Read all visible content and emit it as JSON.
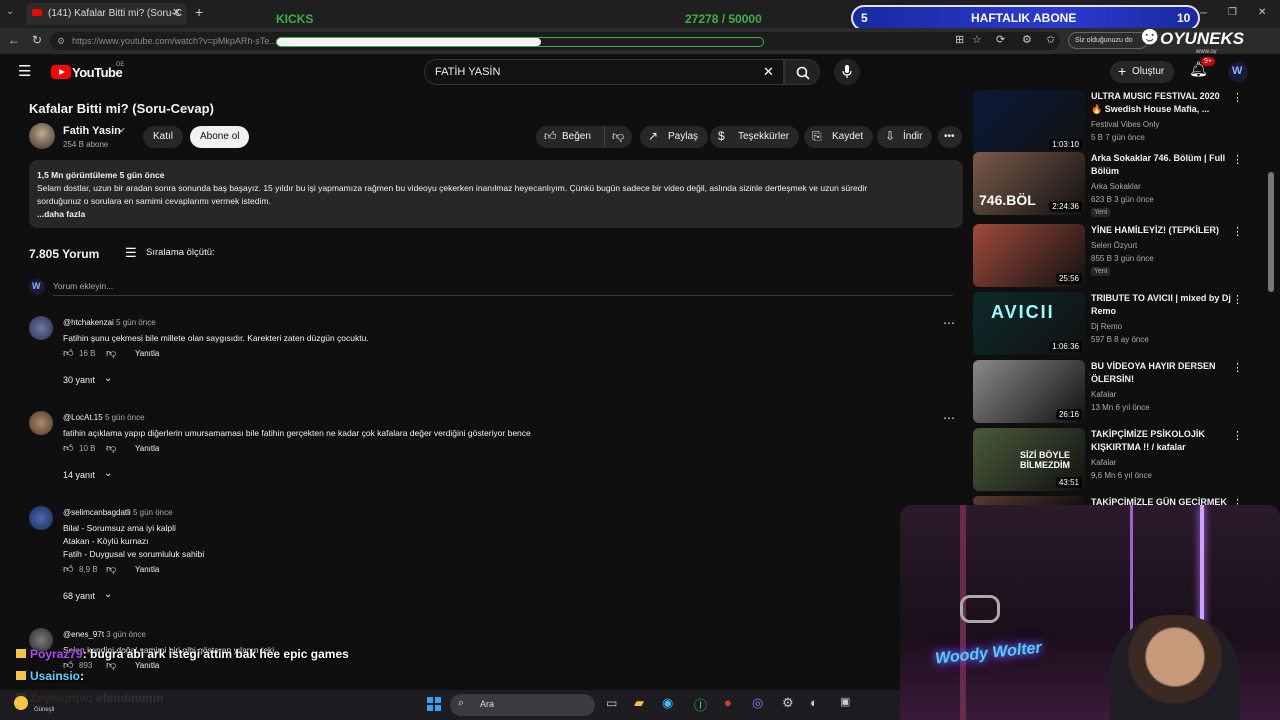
{
  "browser": {
    "tab_title": "(141) Kafalar Bitti mi? (Soru-C",
    "url": "https://www.youtube.com/watch?v=pMkpARh-sTe...",
    "signed_in_hint": "Siz olduğunuzu do"
  },
  "overlay": {
    "kicks_label": "KICKS",
    "kicks_progress": "27278 / 50000",
    "weekly_num_left": "5",
    "weekly_label": "HAFTALIK ABONE",
    "weekly_num_right": "10",
    "brand": "OYUNEKS",
    "brand_sub": "www.oy"
  },
  "header": {
    "logo": "YouTube",
    "logo_region": "DE",
    "search_value": "FATİH YASİN",
    "create_label": "Oluştur",
    "notif_count": "9+"
  },
  "video": {
    "title": "Kafalar Bitti mi? (Soru-Cevap)",
    "channel": "Fatih Yasin",
    "subs": "254 B abone",
    "join_label": "Katıl",
    "subscribe_label": "Abone ol",
    "like_label": "Beğen",
    "share_label": "Paylaş",
    "thanks_label": "Teşekkürler",
    "save_label": "Kaydet",
    "download_label": "İndir"
  },
  "description": {
    "stats": "1,5 Mn görüntüleme  5 gün önce",
    "line1": "Selam dostlar, uzun bir aradan sonra sonunda baş başayız. 15 yıldır bu işi yapmamıza rağmen bu videoyu çekerken inanılmaz heyecanlıyım. Çünkü bugün sadece bir video değil, aslında sizinle dertleşmek ve uzun süredir",
    "line2": "sorduğunuz o sorulara en samimi cevaplarımı vermek istedim.",
    "more": "...daha fazla"
  },
  "comments_header": {
    "count": "7.805 Yorum",
    "sort_label": "Sıralama ölçütü:",
    "add_placeholder": "Yorum ekleyin..."
  },
  "comments": [
    {
      "user": "@htchakenzai",
      "time": "5 gün önce",
      "lines": [
        "Fatihin şunu çekmesi bile millete olan saygısıdır. Karekteri zaten düzgün çocuktu."
      ],
      "likes": "16 B",
      "reply": "Yanıtla",
      "replies": "30 yanıt"
    },
    {
      "user": "@LocAt.15",
      "time": "5 gün önce",
      "lines": [
        "fatihin açıklama yapıp diğerlerin umursamaması bile fatihin gerçekten ne kadar çok kafalara değer verdiğini gösteriyor bence"
      ],
      "likes": "10 B",
      "reply": "Yanıtla",
      "replies": "14 yanıt"
    },
    {
      "user": "@selimcanbagdatli",
      "time": "5 gün önce",
      "lines": [
        "Bilal - Sorumsuz ama iyi kalpli",
        "Atakan - Köylü kurnazı",
        "Fatih - Duygusal ve sorumluluk sahibi"
      ],
      "likes": "8,9 B",
      "reply": "Yanıtla",
      "replies": "68 yanıt"
    },
    {
      "user": "@enes_97t",
      "time": "3 gün önce",
      "lines": [
        "Selen kendini doğal samimi biri gibi gösteren yılanın teki"
      ],
      "likes": "893",
      "reply": "Yanıtla",
      "replies": ""
    }
  ],
  "sidebar": [
    {
      "title": "ULTRA MUSIC FESTIVAL 2020 🔥 Swedish House Mafia, ...",
      "channel": "Festival Vibes Only",
      "meta": "5 B  7 gün önce",
      "duration": "1:03:10",
      "new": "",
      "color": "#0a1a3a"
    },
    {
      "title": "Arka Sokaklar 746. Bölüm | Full Bölüm",
      "channel": "Arka Sokaklar",
      "meta": "623 B  3 gün önce",
      "duration": "2:24:36",
      "new": "Yeni",
      "color": "#7a5a4a"
    },
    {
      "title": "YİNE HAMİLEYİZ! (TEPKİLER)",
      "channel": "Selen Özyurt",
      "meta": "855 B  3 gün önce",
      "duration": "25:56",
      "new": "Yeni",
      "color": "#a04a3a"
    },
    {
      "title": "TRIBUTE TO AVICII | mixed by Dj Remo",
      "channel": "Dj Remo",
      "meta": "597 B  8 ay önce",
      "duration": "1:06:36",
      "new": "",
      "color": "#0e2a2a"
    },
    {
      "title": "BU VİDEOYA HAYIR DERSEN ÖLERSİN!",
      "channel": "Kafalar",
      "meta": "13 Mn  6 yıl önce",
      "duration": "26:16",
      "new": "",
      "color": "#8a8a8a"
    },
    {
      "title": "TAKİPÇİMİZE PSİKOLOJİK KIŞKIRTMA !! / kafalar",
      "channel": "Kafalar",
      "meta": "9,6 Mn  6 yıl önce",
      "duration": "43:51",
      "new": "",
      "color": "#4a5a3a"
    },
    {
      "title": "TAKİPÇİMİZLE GÜN GEÇİRMEK",
      "channel": "",
      "meta": "",
      "duration": "",
      "new": "",
      "color": "#5a3a2a"
    }
  ],
  "thumb_text": {
    "t2": "746.BÖL",
    "t4": "AVICII",
    "t6": "SİZİ BÖYLE BİLMEZDİM"
  },
  "chat": [
    {
      "user": "Poyraz79",
      "text": ": bugra abi ark istegi attim bak hee epic games"
    },
    {
      "user": "Usainsio",
      "text": ": "
    },
    {
      "user": "Zeynepqw",
      "text": ": efendimmm"
    }
  ],
  "taskbar": {
    "search_label": "Ara",
    "weather_label": "Güneşli"
  },
  "webcam": {
    "neon_text": "Woody Wolter"
  }
}
